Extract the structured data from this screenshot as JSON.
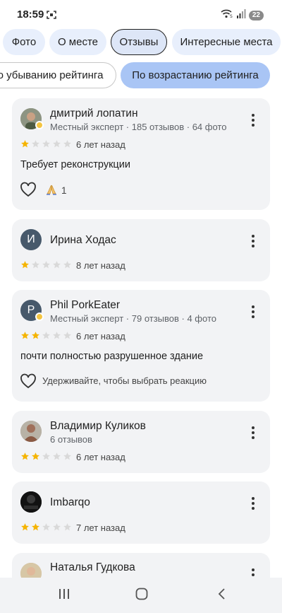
{
  "status_bar": {
    "time": "18:59",
    "battery": "22"
  },
  "tabs": [
    "Фото",
    "О месте",
    "Отзывы",
    "Интересные места"
  ],
  "sort_options": [
    "о убыванию рейтинга",
    "По возрастанию рейтинга"
  ],
  "reviews": [
    {
      "name": "дмитрий лопатин",
      "meta": "Местный эксперт · 185 отзывов · 64 фото",
      "rating": 1,
      "ago": "6 лет назад",
      "text": "Требует реконструкции",
      "reaction_count": "1"
    },
    {
      "name": "Ирина Ходас",
      "initial": "И",
      "rating": 1,
      "ago": "8 лет назад"
    },
    {
      "name": "Phil PorkEater",
      "initial": "P",
      "meta": "Местный эксперт · 79 отзывов · 4 фото",
      "rating": 2,
      "ago": "6 лет назад",
      "text": "почти полностью разрушенное здание",
      "hint": "Удерживайте, чтобы выбрать реакцию"
    },
    {
      "name": "Владимир Куликов",
      "meta": "6 отзывов",
      "rating": 2,
      "ago": "6 лет назад"
    },
    {
      "name": "Imbarqo",
      "rating": 2,
      "ago": "7 лет назад"
    },
    {
      "name": "Наталья Гудкова"
    }
  ],
  "colors": {
    "star_filled": "#f5b400",
    "star_empty": "#d9d9d9",
    "active_chip": "#a9c5f5",
    "tab_bg": "#e8effc",
    "card_bg": "#f2f3f5"
  }
}
